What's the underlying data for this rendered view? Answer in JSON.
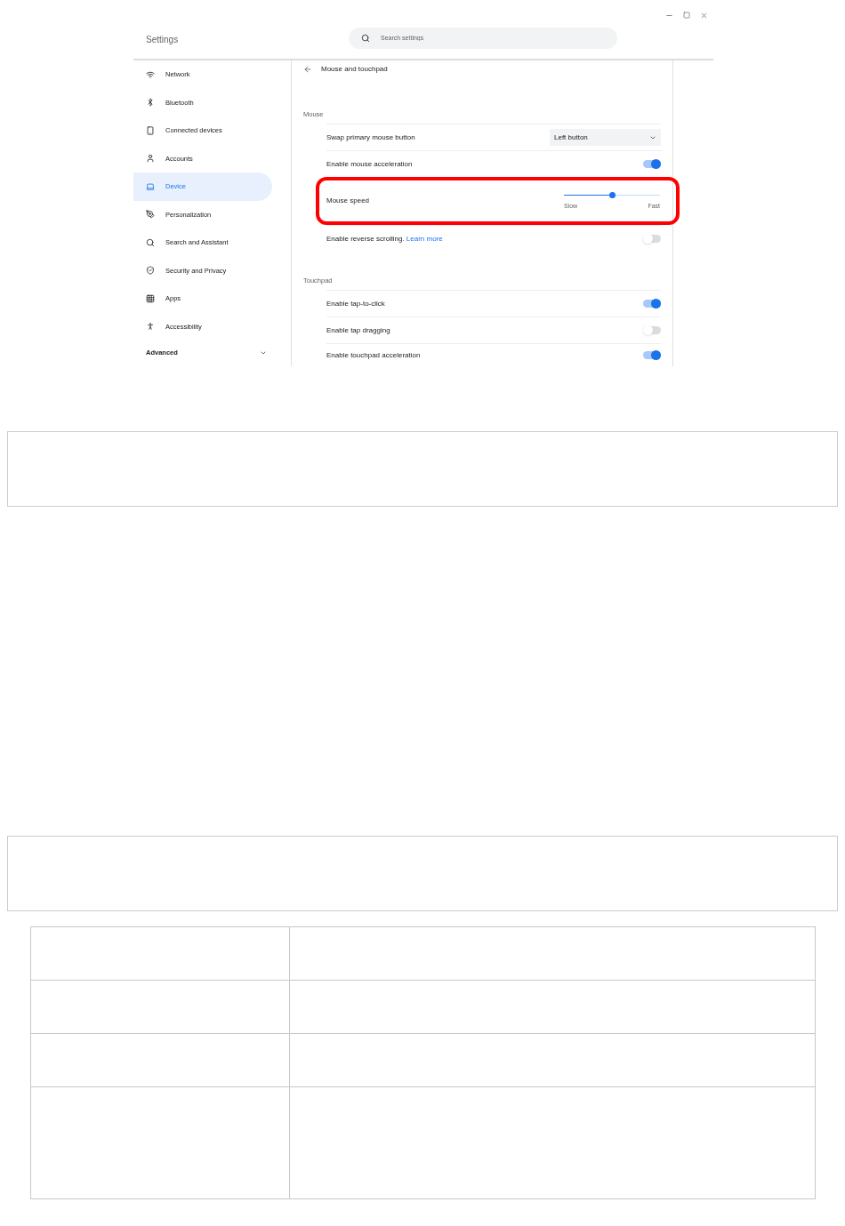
{
  "header": {
    "title": "Settings",
    "search": {
      "placeholder": "Search settings"
    }
  },
  "sidebar": {
    "items": [
      {
        "label": "Network",
        "selected": false
      },
      {
        "label": "Bluetooth",
        "selected": false
      },
      {
        "label": "Connected devices",
        "selected": false
      },
      {
        "label": "Accounts",
        "selected": false
      },
      {
        "label": "Device",
        "selected": true
      },
      {
        "label": "Personalization",
        "selected": false
      },
      {
        "label": "Search and Assistant",
        "selected": false
      },
      {
        "label": "Security and Privacy",
        "selected": false
      },
      {
        "label": "Apps",
        "selected": false
      },
      {
        "label": "Accessibility",
        "selected": false
      }
    ],
    "advanced": {
      "label": "Advanced",
      "expanded": false
    }
  },
  "page": {
    "title": "Mouse and touchpad",
    "sections": [
      {
        "title": "Mouse",
        "rows": [
          {
            "kind": "select",
            "label": "Swap primary mouse button",
            "value": "Left button"
          },
          {
            "kind": "toggle",
            "label": "Enable mouse acceleration",
            "on": true
          },
          {
            "kind": "slider",
            "label": "Mouse speed",
            "level": 0.5,
            "min_label": "Slow",
            "max_label": "Fast",
            "highlighted": true
          },
          {
            "kind": "toggle",
            "label": "Enable reverse scrolling.",
            "link": "Learn more",
            "on": false
          }
        ]
      },
      {
        "title": "Touchpad",
        "rows": [
          {
            "kind": "toggle",
            "label": "Enable tap-to-click",
            "on": true
          },
          {
            "kind": "toggle",
            "label": "Enable tap dragging",
            "on": false
          },
          {
            "kind": "toggle",
            "label": "Enable touchpad acceleration",
            "on": true
          }
        ]
      }
    ]
  }
}
